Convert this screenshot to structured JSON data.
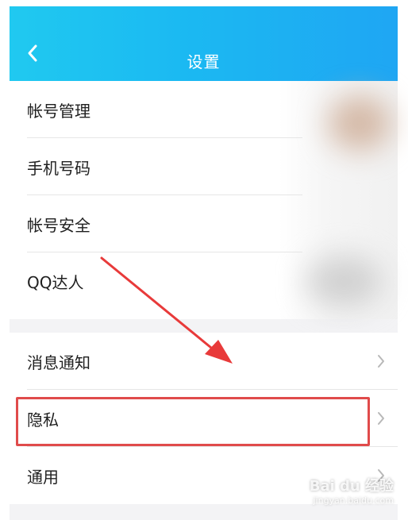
{
  "header": {
    "title": "设置"
  },
  "settings": {
    "group1": [
      {
        "label": "帐号管理"
      },
      {
        "label": "手机号码"
      },
      {
        "label": "帐号安全"
      },
      {
        "label": "QQ达人"
      }
    ],
    "group2": [
      {
        "label": "消息通知"
      },
      {
        "label": "隐私"
      },
      {
        "label": "通用"
      }
    ]
  },
  "watermark": {
    "text": "Bai du 经验",
    "url": "jingyan.baidu.com"
  },
  "colors": {
    "header_start": "#20c9f0",
    "header_end": "#1fa6f3",
    "highlight": "#e04b4b",
    "arrow": "#e83a3a"
  }
}
